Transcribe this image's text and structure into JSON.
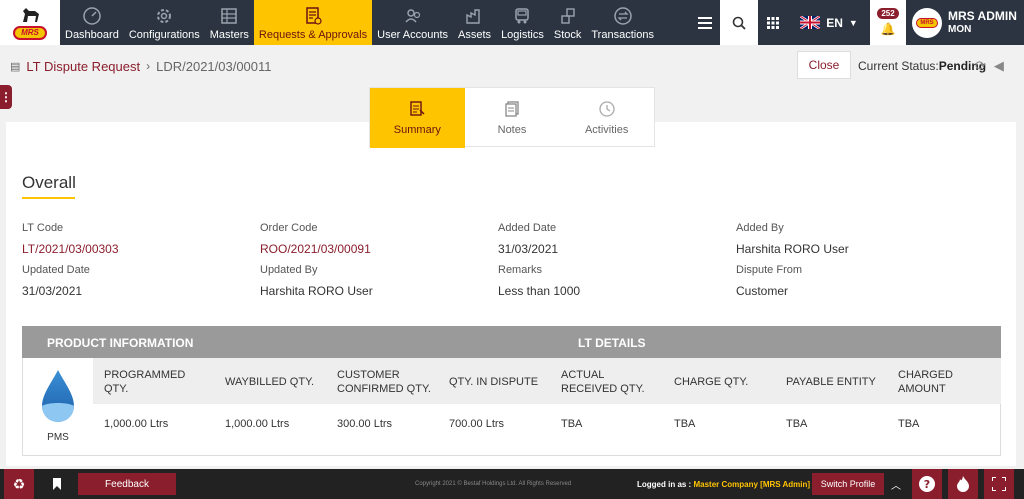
{
  "brand": {
    "logo_text": "MRS"
  },
  "nav": {
    "items": [
      {
        "label": "Dashboard",
        "icon": "dashboard-icon"
      },
      {
        "label": "Configurations",
        "icon": "gear-icon"
      },
      {
        "label": "Masters",
        "icon": "masters-icon"
      },
      {
        "label": "Requests & Approvals",
        "icon": "requests-icon",
        "active": true
      },
      {
        "label": "User Accounts",
        "icon": "user-accounts-icon"
      },
      {
        "label": "Assets",
        "icon": "assets-icon"
      },
      {
        "label": "Logistics",
        "icon": "truck-icon"
      },
      {
        "label": "Stock",
        "icon": "stock-icon"
      },
      {
        "label": "Transactions",
        "icon": "transactions-icon"
      }
    ],
    "language": "EN",
    "notifications": "252",
    "user_name": "MRS ADMIN",
    "user_role": "MON"
  },
  "breadcrumb": {
    "parent": "LT Dispute Request",
    "current": "LDR/2021/03/00011",
    "close_label": "Close",
    "status_label": "Current Status:",
    "status_value": "Pending"
  },
  "tabs": [
    {
      "label": "Summary",
      "active": true
    },
    {
      "label": "Notes"
    },
    {
      "label": "Activities"
    }
  ],
  "overall": {
    "title": "Overall",
    "fields": {
      "lt_code": {
        "label": "LT Code",
        "value": "LT/2021/03/00303"
      },
      "order_code": {
        "label": "Order Code",
        "value": "ROO/2021/03/00091"
      },
      "added_date": {
        "label": "Added Date",
        "value": "31/03/2021"
      },
      "added_by": {
        "label": "Added By",
        "value": "Harshita RORO User"
      },
      "updated_date": {
        "label": "Updated Date",
        "value": "31/03/2021"
      },
      "updated_by": {
        "label": "Updated By",
        "value": "Harshita RORO User"
      },
      "remarks": {
        "label": "Remarks",
        "value": "Less than 1000"
      },
      "dispute_from": {
        "label": "Dispute From",
        "value": "Customer"
      }
    }
  },
  "table": {
    "product_info_header": "PRODUCT INFORMATION",
    "lt_details_header": "LT DETAILS",
    "product_name": "PMS",
    "columns": {
      "programmed": "PROGRAMMED QTY.",
      "waybilled": "WAYBILLED QTY.",
      "customer_confirmed": "CUSTOMER CONFIRMED QTY.",
      "in_dispute": "QTY. IN DISPUTE",
      "actual_received": "ACTUAL RECEIVED QTY.",
      "charge": "CHARGE QTY.",
      "payable_entity": "PAYABLE ENTITY",
      "charged_amount": "CHARGED AMOUNT"
    },
    "row": {
      "programmed": "1,000.00 Ltrs",
      "waybilled": "1,000.00 Ltrs",
      "customer_confirmed": "300.00 Ltrs",
      "in_dispute": "700.00 Ltrs",
      "actual_received": "TBA",
      "charge": "TBA",
      "payable_entity": "TBA",
      "charged_amount": "TBA"
    }
  },
  "footer": {
    "feedback_label": "Feedback",
    "copyright": "Copyright 2021 © Bestaf Holdings Ltd. All Rights Reserved",
    "logged_in_label": "Logged in as :",
    "logged_in_value": "Master Company [MRS Admin]",
    "switch_profile_label": "Switch Profile"
  },
  "colors": {
    "primary": "#8b1e2d",
    "accent": "#ffc400",
    "nav_bg": "#2b3440"
  }
}
